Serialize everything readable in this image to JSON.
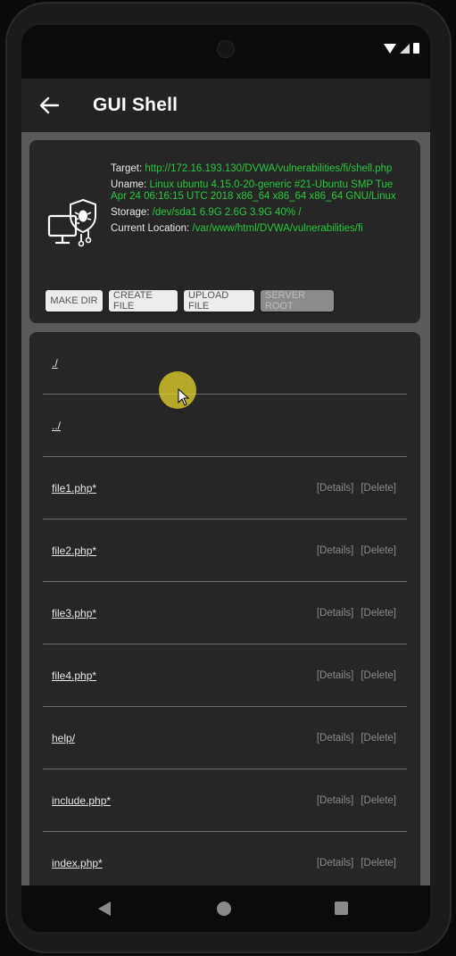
{
  "app_bar": {
    "title": "GUI Shell"
  },
  "info": {
    "target_label": "Target:",
    "target_value": "http://172.16.193.130/DVWA/vulnerabilities/fi/shell.php",
    "uname_label": "Uname:",
    "uname_value": "Linux ubuntu 4.15.0-20-generic #21-Ubuntu SMP Tue Apr 24 06:16:15 UTC 2018 x86_64 x86_64 x86_64 GNU/Linux",
    "storage_label": "Storage:",
    "storage_value": "/dev/sda1 6.9G 2.6G 3.9G 40% /",
    "location_label": "Current Location:",
    "location_value": "/var/www/html/DVWA/vulnerabilities/fi"
  },
  "buttons": {
    "make_dir": "MAKE DIR",
    "create_file": "CREATE FILE",
    "upload_file": "UPLOAD FILE",
    "server_root": "SERVER ROOT"
  },
  "files": [
    {
      "name": "./",
      "details": "",
      "delete": ""
    },
    {
      "name": "../",
      "details": "",
      "delete": ""
    },
    {
      "name": "file1.php*",
      "details": "[Details]",
      "delete": "[Delete]"
    },
    {
      "name": "file2.php*",
      "details": "[Details]",
      "delete": "[Delete]"
    },
    {
      "name": "file3.php*",
      "details": "[Details]",
      "delete": "[Delete]"
    },
    {
      "name": "file4.php*",
      "details": "[Details]",
      "delete": "[Delete]"
    },
    {
      "name": "help/",
      "details": "[Details]",
      "delete": "[Delete]"
    },
    {
      "name": "include.php*",
      "details": "[Details]",
      "delete": "[Delete]"
    },
    {
      "name": "index.php*",
      "details": "[Details]",
      "delete": "[Delete]"
    }
  ],
  "colors": {
    "accent_green": "#27c93f",
    "app_bar_bg": "#222222",
    "card_bg": "#262626"
  }
}
